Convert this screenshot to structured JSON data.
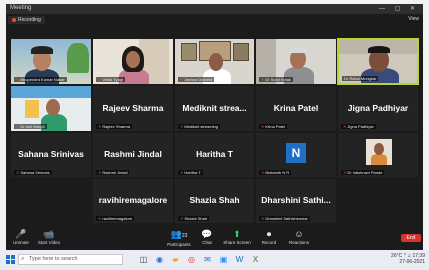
{
  "window": {
    "title": "Meeting",
    "controls": "— ▢ ✕"
  },
  "meeting": {
    "recording_label": "Recording",
    "view_label": "View"
  },
  "participants": [
    {
      "display_name": "",
      "tag": "Bhupendra Kumar Nasar",
      "muted": true,
      "video": true
    },
    {
      "display_name": "",
      "tag": "Vinita Tyagi",
      "muted": true,
      "video": true
    },
    {
      "display_name": "",
      "tag": "Jashna Dwivedi",
      "muted": true,
      "video": true
    },
    {
      "display_name": "",
      "tag": "Dr Sunil Kotak",
      "muted": true,
      "video": true
    },
    {
      "display_name": "",
      "tag": "Dr Rahul Mungkar",
      "muted": false,
      "video": true,
      "active": true
    },
    {
      "display_name": "",
      "tag": "Dr Anil Manjili",
      "muted": true,
      "video": true
    },
    {
      "display_name": "Rajeev Sharma",
      "tag": "Rajeev Sharma",
      "muted": true
    },
    {
      "display_name": "Mediknit strea...",
      "tag": "Mediknit streaming",
      "muted": true
    },
    {
      "display_name": "Krina Patel",
      "tag": "Krina Patel",
      "muted": true
    },
    {
      "display_name": "Jigna Padhiyar",
      "tag": "Jigna Padhiyar",
      "muted": true
    },
    {
      "display_name": "Sahana Srinivas",
      "tag": "Sahana Srinivas",
      "muted": true
    },
    {
      "display_name": "Rashmi Jindal",
      "tag": "Rashmi Jindal",
      "muted": true
    },
    {
      "display_name": "Haritha T",
      "tag": "Haritha T",
      "muted": true
    },
    {
      "display_name": "",
      "tag": "Nishanth N R",
      "muted": true,
      "avatar_letter": "N"
    },
    {
      "display_name": "",
      "tag": "Dr Vaishnavi Pande",
      "muted": true,
      "video": true
    },
    {
      "display_name": "ravihiremagalore",
      "tag": "ravihiremagalore",
      "muted": true
    },
    {
      "display_name": "Shazia Shah",
      "tag": "Shazia Shah",
      "muted": true
    },
    {
      "display_name": "Dharshini Sathi...",
      "tag": "Dharshini Sathishkumar",
      "muted": true
    }
  ],
  "toolbar": {
    "unmute": "Unmute",
    "start_video": "Start Video",
    "participants": "Participants",
    "participants_count": "23",
    "chat": "Chat",
    "share_screen": "Share Screen",
    "record": "Record",
    "reactions": "Reactions",
    "end": "End"
  },
  "taskbar": {
    "search_placeholder": "Type here to search",
    "weather": "26°C",
    "time": "17:39",
    "date": "27-06-2021"
  },
  "colors": {
    "active_speaker": "#b6d634",
    "muted": "#e74c3c",
    "avatar": "#1f6fc5",
    "share": "#2ecc71"
  }
}
